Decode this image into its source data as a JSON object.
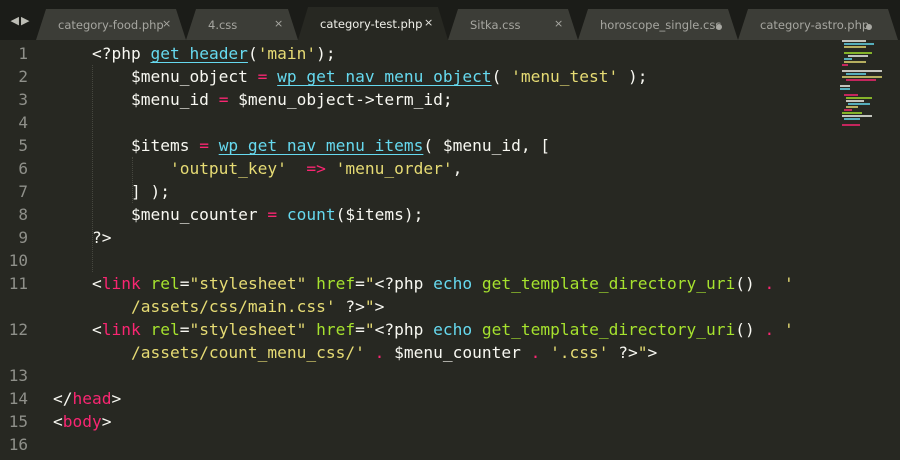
{
  "tabs": [
    {
      "label": "category-food.php",
      "state": "close",
      "active": false
    },
    {
      "label": "4.css",
      "state": "close",
      "active": false
    },
    {
      "label": "category-test.php",
      "state": "close",
      "active": true
    },
    {
      "label": "Sitka.css",
      "state": "close",
      "active": false
    },
    {
      "label": "horoscope_single.css",
      "state": "dirty",
      "active": false
    },
    {
      "label": "category-astro.php",
      "state": "dirty",
      "active": false
    }
  ],
  "nav": {
    "back_icon": "◀",
    "forward_icon": "▶"
  },
  "close_glyph": "×",
  "colors": {
    "background": "#272822",
    "keyword_red": "#f92672",
    "string_yellow": "#e6db74",
    "function_blue": "#66d9ef",
    "attr_green": "#a6e22e",
    "gutter_gray": "#8f908a"
  },
  "gutter": [
    "1",
    "2",
    "3",
    "4",
    "5",
    "6",
    "7",
    "8",
    "9",
    "10",
    "11",
    "",
    "12",
    "",
    "13",
    "14",
    "15",
    "16"
  ],
  "code_lines": [
    [
      [
        "    <?php ",
        "t-php"
      ],
      [
        "get_header",
        "t-func"
      ],
      [
        "(",
        "t-plain"
      ],
      [
        "'main'",
        "t-str"
      ],
      [
        ");",
        "t-plain"
      ]
    ],
    [
      [
        "        $menu_object ",
        "t-var"
      ],
      [
        "=",
        "t-op"
      ],
      [
        " ",
        "t-plain"
      ],
      [
        "wp_get_nav_menu_object",
        "t-func"
      ],
      [
        "( ",
        "t-plain"
      ],
      [
        "'menu_test'",
        "t-str"
      ],
      [
        " );",
        "t-plain"
      ]
    ],
    [
      [
        "        $menu_id ",
        "t-var"
      ],
      [
        "=",
        "t-op"
      ],
      [
        " $menu_object->term_id;",
        "t-var"
      ]
    ],
    [],
    [
      [
        "        $items ",
        "t-var"
      ],
      [
        "=",
        "t-op"
      ],
      [
        " ",
        "t-plain"
      ],
      [
        "wp_get_nav_menu_items",
        "t-func"
      ],
      [
        "( $menu_id, [",
        "t-plain"
      ]
    ],
    [
      [
        "            ",
        "t-plain"
      ],
      [
        "'output_key'",
        "t-str"
      ],
      [
        "  ",
        "t-plain"
      ],
      [
        "=>",
        "t-op"
      ],
      [
        " ",
        "t-plain"
      ],
      [
        "'menu_order'",
        "t-str"
      ],
      [
        ",",
        "t-plain"
      ]
    ],
    [
      [
        "        ] );",
        "t-plain"
      ]
    ],
    [
      [
        "        $menu_counter ",
        "t-var"
      ],
      [
        "=",
        "t-op"
      ],
      [
        " ",
        "t-plain"
      ],
      [
        "count",
        "t-fn"
      ],
      [
        "($items);",
        "t-plain"
      ]
    ],
    [
      [
        "    ?>",
        "t-php"
      ]
    ],
    [],
    [
      [
        "    <",
        "t-plain"
      ],
      [
        "link",
        "t-tag"
      ],
      [
        " ",
        "t-plain"
      ],
      [
        "rel",
        "t-attr"
      ],
      [
        "=",
        "t-plain"
      ],
      [
        "\"stylesheet\"",
        "t-str"
      ],
      [
        " ",
        "t-plain"
      ],
      [
        "href",
        "t-attr"
      ],
      [
        "=",
        "t-plain"
      ],
      [
        "\"",
        "t-str"
      ],
      [
        "<?php ",
        "t-php"
      ],
      [
        "echo",
        "t-fn"
      ],
      [
        " ",
        "t-plain"
      ],
      [
        "get_template_directory_uri",
        "t-attr"
      ],
      [
        "() ",
        "t-plain"
      ],
      [
        ".",
        "t-op"
      ],
      [
        " '",
        "t-str"
      ]
    ],
    [
      [
        "        /assets/css/main.css'",
        "t-str"
      ],
      [
        " ?>",
        "t-php"
      ],
      [
        "\"",
        "t-str"
      ],
      [
        ">",
        "t-plain"
      ]
    ],
    [
      [
        "    <",
        "t-plain"
      ],
      [
        "link",
        "t-tag"
      ],
      [
        " ",
        "t-plain"
      ],
      [
        "rel",
        "t-attr"
      ],
      [
        "=",
        "t-plain"
      ],
      [
        "\"stylesheet\"",
        "t-str"
      ],
      [
        " ",
        "t-plain"
      ],
      [
        "href",
        "t-attr"
      ],
      [
        "=",
        "t-plain"
      ],
      [
        "\"",
        "t-str"
      ],
      [
        "<?php ",
        "t-php"
      ],
      [
        "echo",
        "t-fn"
      ],
      [
        " ",
        "t-plain"
      ],
      [
        "get_template_directory_uri",
        "t-attr"
      ],
      [
        "() ",
        "t-plain"
      ],
      [
        ".",
        "t-op"
      ],
      [
        " '",
        "t-str"
      ]
    ],
    [
      [
        "        /assets/count_menu_css/'",
        "t-str"
      ],
      [
        " ",
        "t-plain"
      ],
      [
        ".",
        "t-op"
      ],
      [
        " $menu_counter ",
        "t-var"
      ],
      [
        ".",
        "t-op"
      ],
      [
        " ",
        "t-plain"
      ],
      [
        "'.css'",
        "t-str"
      ],
      [
        " ?>",
        "t-php"
      ],
      [
        "\"",
        "t-str"
      ],
      [
        ">",
        "t-plain"
      ]
    ],
    [],
    [
      [
        "</",
        "t-plain"
      ],
      [
        "head",
        "t-tag"
      ],
      [
        ">",
        "t-plain"
      ]
    ],
    [
      [
        "<",
        "t-plain"
      ],
      [
        "body",
        "t-tag"
      ],
      [
        ">",
        "t-plain"
      ]
    ],
    []
  ]
}
